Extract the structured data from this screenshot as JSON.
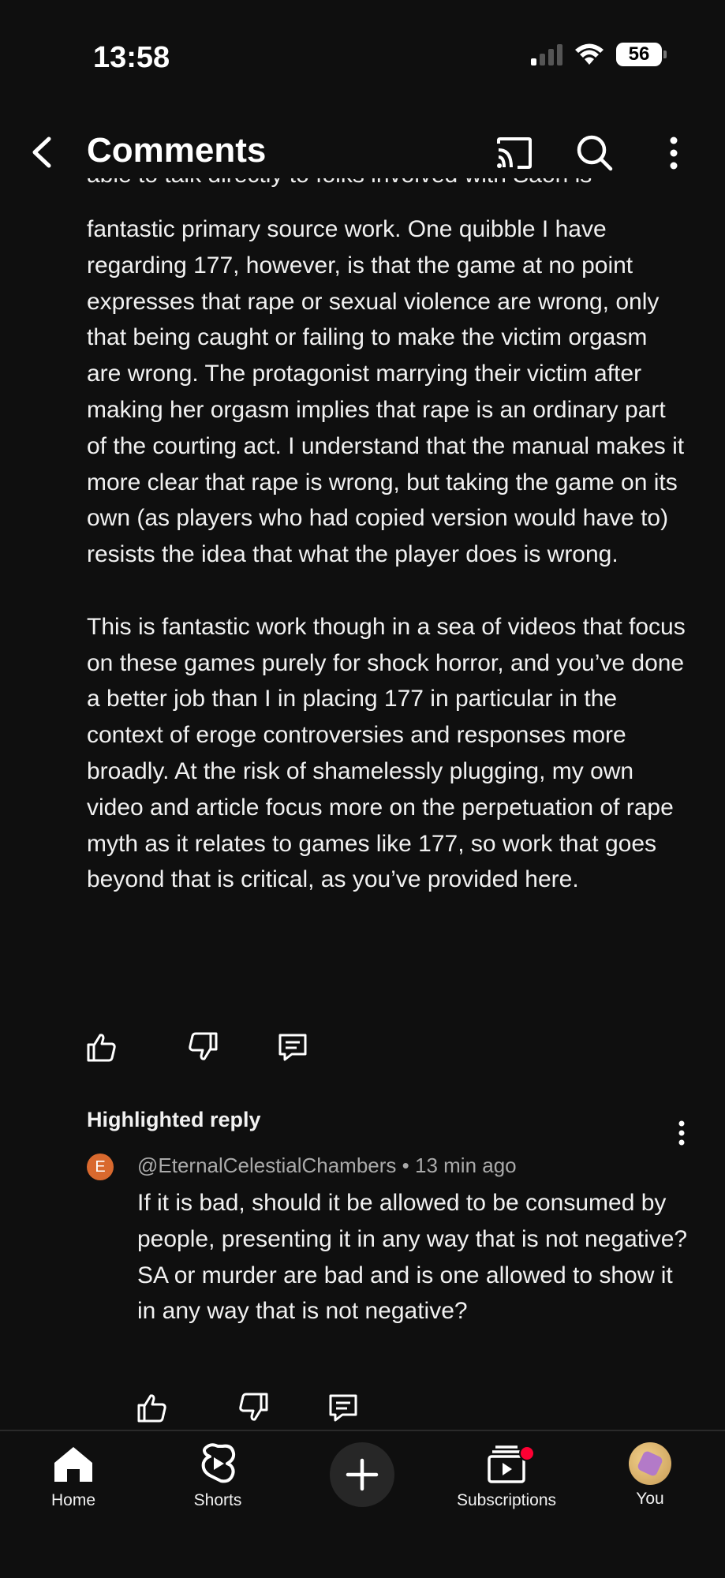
{
  "status_bar": {
    "time": "13:58",
    "battery": "56"
  },
  "header": {
    "title": "Comments",
    "icons": [
      "back-icon",
      "cast-icon",
      "search-icon",
      "more-vertical-icon"
    ]
  },
  "comment": {
    "clipped_top_line": "able to talk directly to folks involved with Saori is",
    "paragraphs": [
      "fantastic primary source work. One quibble I have regarding 177, however, is that the game at no point expresses that rape or sexual violence are wrong, only that being caught or failing to make the victim orgasm are wrong. The protagonist marrying their victim after making her orgasm implies that rape is an ordinary part of the courting act. I understand that the manual makes it more clear that rape is wrong, but taking the game on its own (as players who had copied version would have to) resists the idea that what the player does is wrong.",
      "This is fantastic work though in a sea of videos that focus on these games purely for shock horror, and you’ve done a better job than I in placing 177 in particular in the context of eroge controversies and responses more broadly. At the risk of shamelessly plugging, my own video and article focus more on the perpetuation of rape myth as it relates to games like 177, so work that goes beyond that is critical, as you’ve provided here."
    ]
  },
  "highlighted_reply": {
    "label": "Highlighted reply",
    "avatar_letter": "E",
    "author": "@EternalCelestialChambers",
    "separator": "•",
    "time": "13 min ago",
    "text": "If it is bad, should it be allowed to be consumed by people, presenting it in any way that is not negative? SA or murder are bad and is one allowed to show it in any way that is not negative?"
  },
  "bottom_nav": {
    "home": "Home",
    "shorts": "Shorts",
    "subscriptions": "Subscriptions",
    "you": "You"
  },
  "colors": {
    "background": "#0f0f0f",
    "text": "#f1f1f1",
    "muted": "#aaaaaa",
    "avatar": "#d9692e",
    "notification": "#ff0033"
  }
}
